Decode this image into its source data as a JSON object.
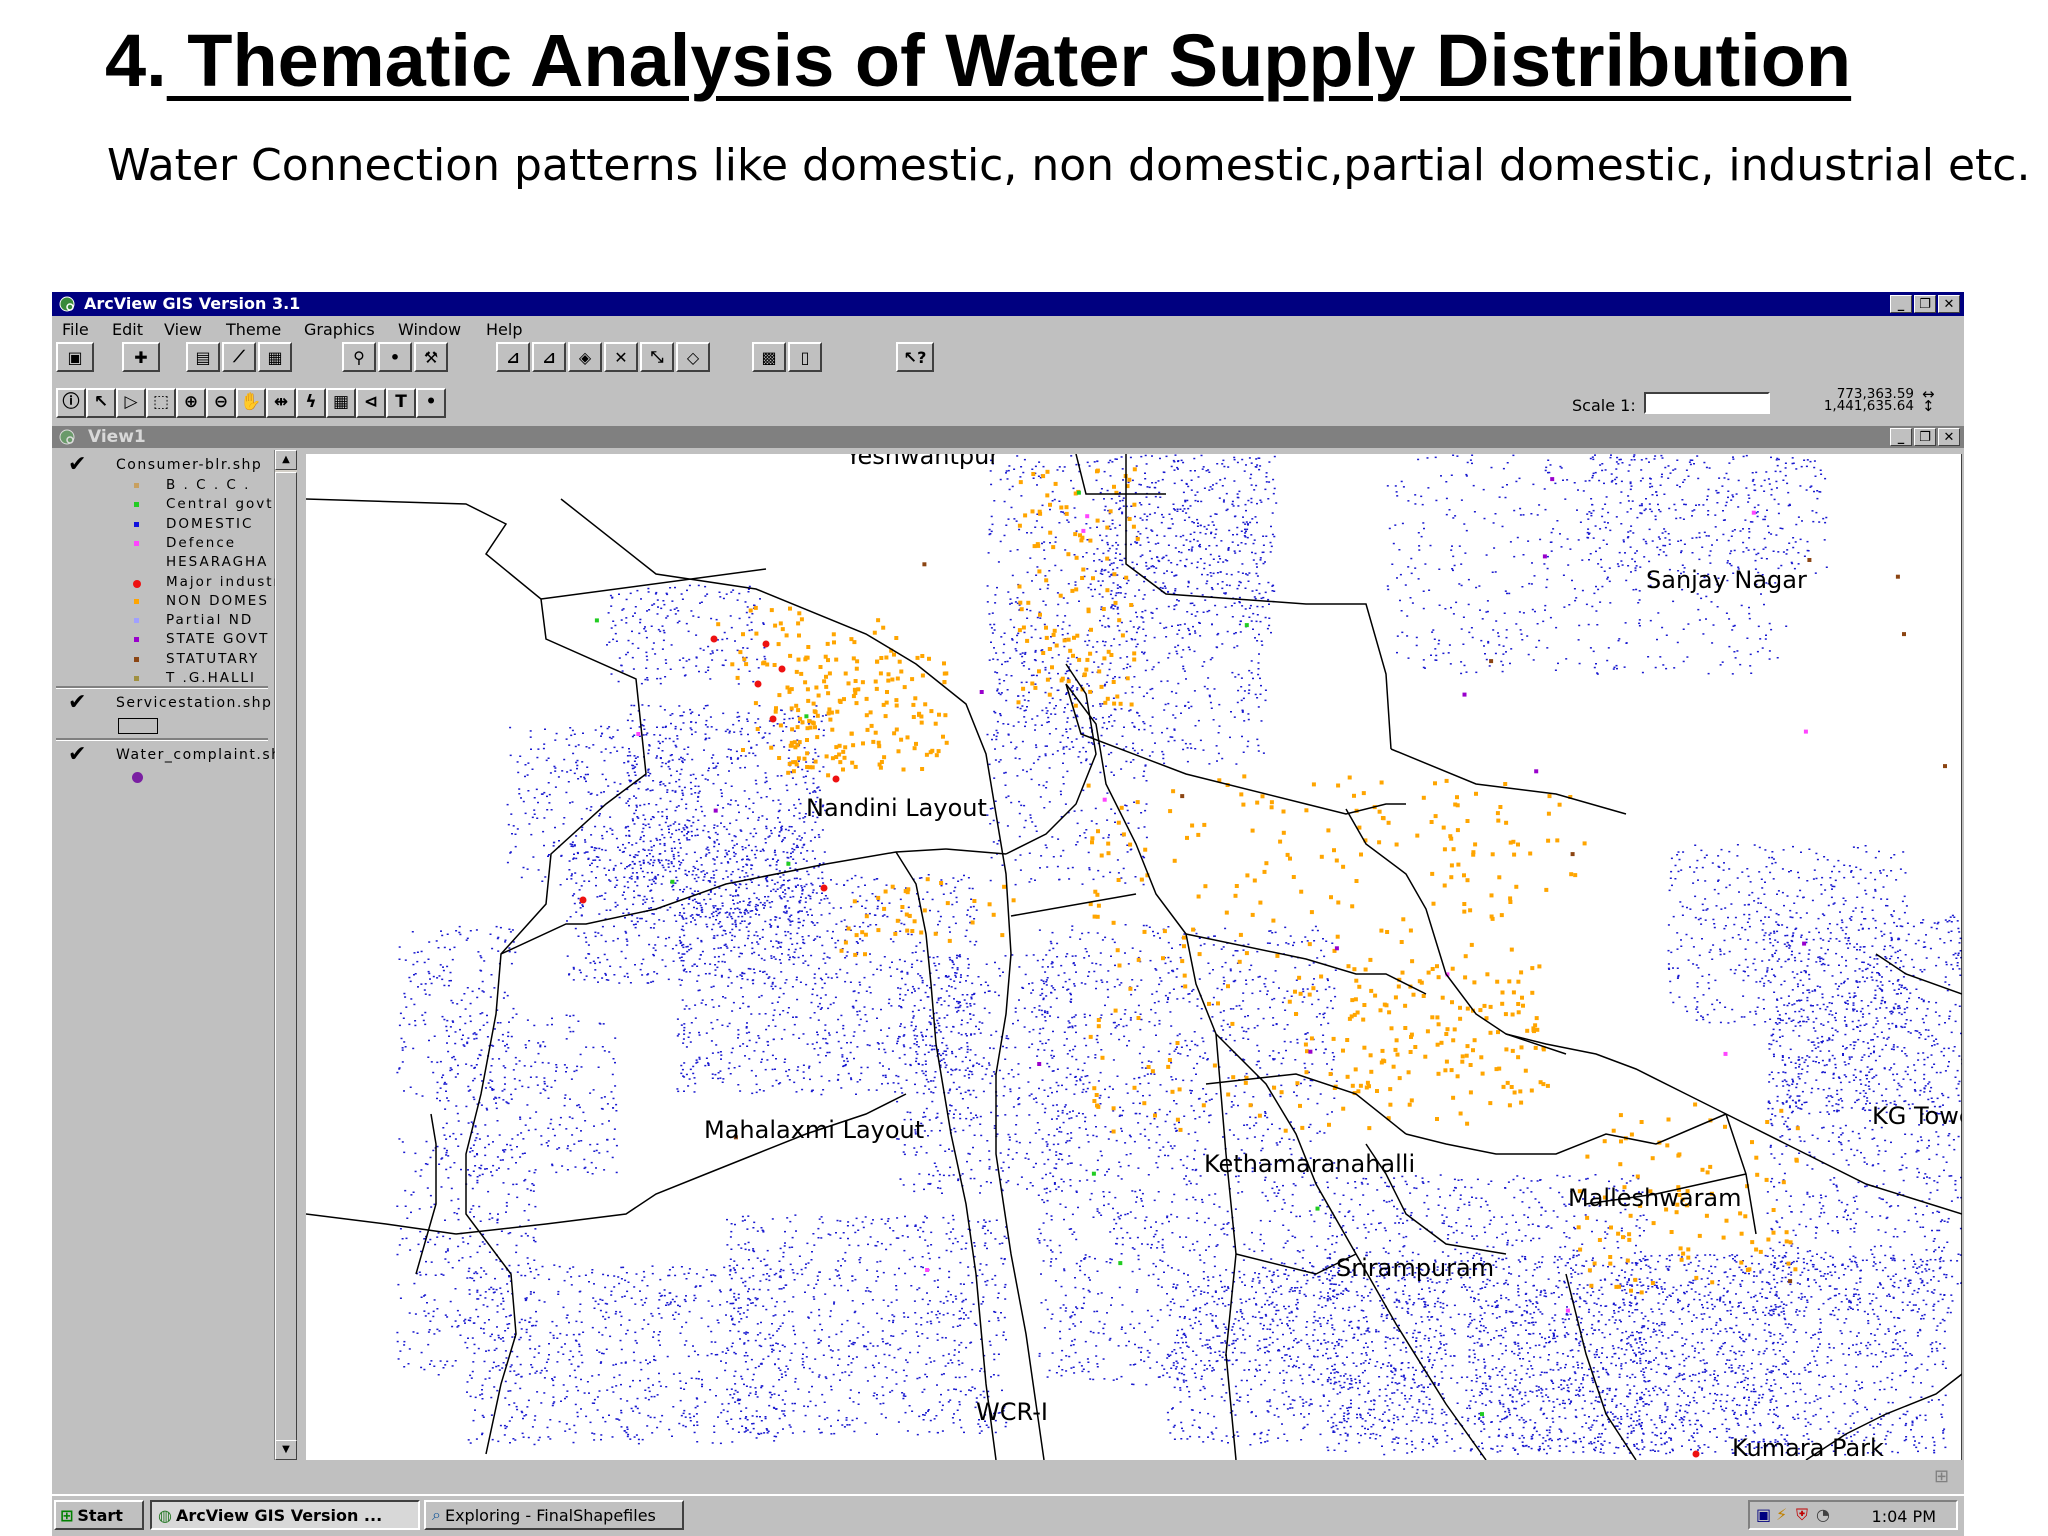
{
  "slide": {
    "title_num": "4.",
    "title_text": " Thematic Analysis of Water Supply Distribution",
    "subtitle": "Water Connection patterns like domestic, non domestic,partial domestic, industrial etc."
  },
  "app": {
    "title": "ArcView GIS Version 3.1",
    "view_title": "View1",
    "menu": [
      "File",
      "Edit",
      "View",
      "Theme",
      "Graphics",
      "Window",
      "Help"
    ],
    "scale_label": "Scale 1:",
    "scale_value": "",
    "coord_x": "773,363.59",
    "coord_y": "1,441,635.64"
  },
  "themes": [
    {
      "name": "Consumer-blr.shp",
      "checked": true,
      "legend": [
        {
          "label": "B . C . C .",
          "color": "#c8a060"
        },
        {
          "label": "Central govt",
          "color": "#22cc22"
        },
        {
          "label": "DOMESTIC",
          "color": "#1010dd"
        },
        {
          "label": "Defence",
          "color": "#ff44ff"
        },
        {
          "label": "HESARAGHA",
          "color": "#c0c0c0"
        },
        {
          "label": "Major industri",
          "color": "#ee1111"
        },
        {
          "label": "NON DOMES",
          "color": "#ffa500"
        },
        {
          "label": "Partial ND",
          "color": "#a0a0ff"
        },
        {
          "label": "STATE GOVT",
          "color": "#9900cc"
        },
        {
          "label": "STATUTARY",
          "color": "#8b4513"
        },
        {
          "label": "T .G.HALLI",
          "color": "#a09040"
        }
      ]
    },
    {
      "name": "Servicestation.shp",
      "checked": true
    },
    {
      "name": "Water_complaint.sh",
      "checked": true,
      "symbol_color": "#7a1fa2"
    }
  ],
  "map_labels": [
    {
      "text": "Yeshwantpur"
    },
    {
      "text": "Sanjay Nagar"
    },
    {
      "text": "Nandini Layout"
    },
    {
      "text": "Mahalaxmi Layout"
    },
    {
      "text": "KG Tower"
    },
    {
      "text": "Kethamaranahalli"
    },
    {
      "text": "Malleshwaram"
    },
    {
      "text": "Srirampuram"
    },
    {
      "text": "WCR-I"
    },
    {
      "text": "Kumara Park"
    }
  ],
  "taskbar": {
    "start": "Start",
    "task1": "ArcView GIS Version ...",
    "task2": "Exploring - FinalShapefiles",
    "clock": "1:04 PM"
  }
}
